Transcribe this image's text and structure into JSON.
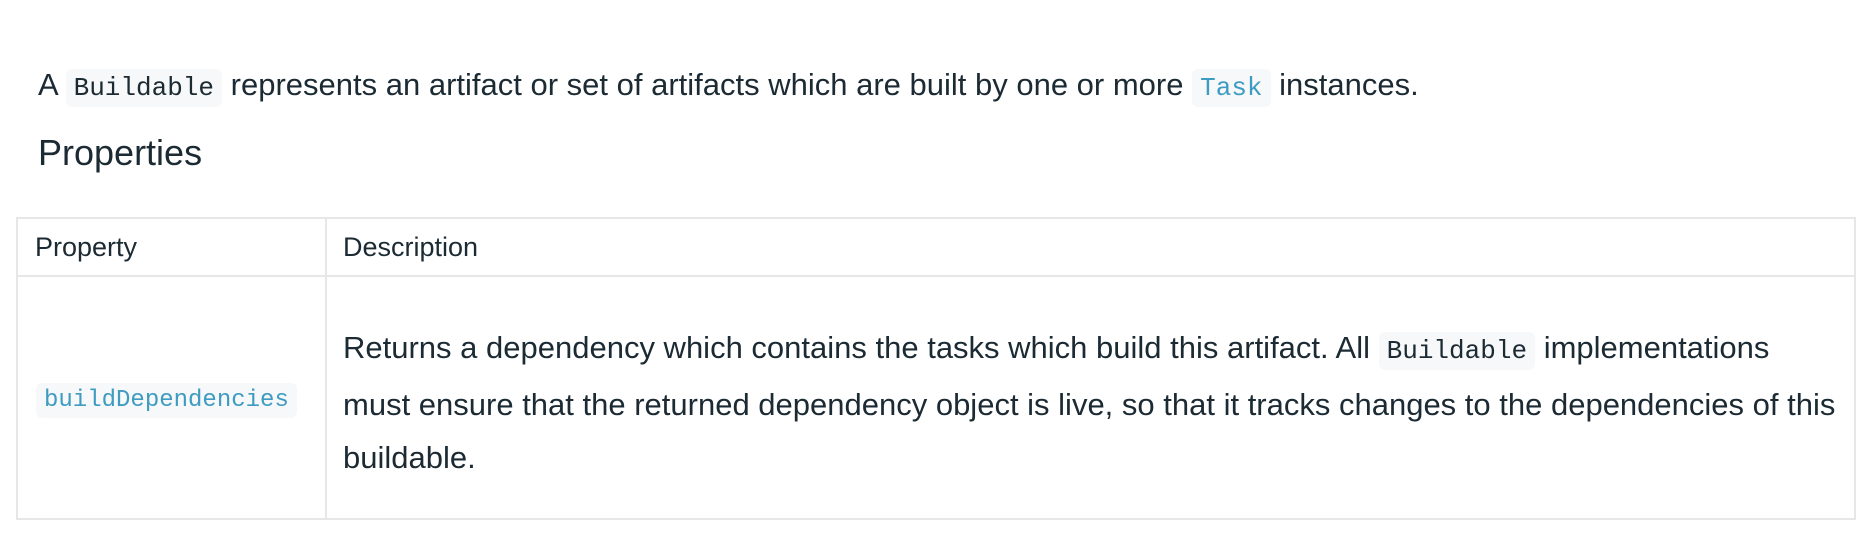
{
  "intro": {
    "prefix": "A",
    "code_buildable": "Buildable",
    "middle": "represents an artifact or set of artifacts which are built by one or more",
    "code_task": "Task",
    "suffix": "instances."
  },
  "section": {
    "heading": "Properties"
  },
  "table": {
    "headers": [
      "Property",
      "Description"
    ],
    "rows": [
      {
        "property": "buildDependencies",
        "description_before": "Returns a dependency which contains the tasks which build this artifact. All",
        "description_code": "Buildable",
        "description_after": "implementations must ensure that the returned dependency object is live, so that it tracks changes to the dependencies of this buildable."
      }
    ]
  },
  "colors": {
    "text": "#1b2a33",
    "link_code": "#3e9bc2",
    "code_background": "#f7f8f9",
    "border": "#e5e7e9"
  }
}
